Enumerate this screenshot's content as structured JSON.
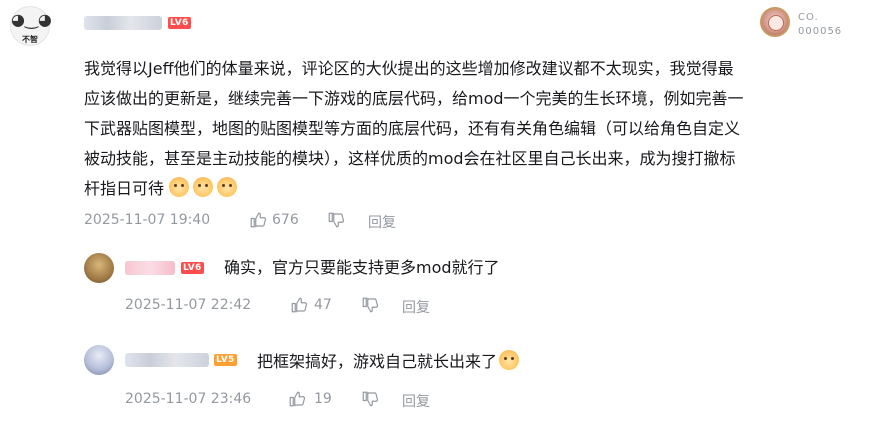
{
  "comment": {
    "author_avatar_text": "不智",
    "level_badge": "LV6",
    "medal": {
      "line1": "CO.",
      "line2": "000056"
    },
    "text_lines": [
      "我觉得以Jeff他们的体量来说，评论区的大伙提出的这些增加修改建议都不太现实，我觉得最",
      "应该做出的更新是，继续完善一下游戏的底层代码，给mod一个完美的生长环境，例如完善一",
      "下武器贴图模型，地图的贴图模型等方面的底层代码，还有有关角色编辑（可以给角色自定义",
      "被动技能，甚至是主动技能的模块），这样优质的mod会在社区里自己长出来，成为搜打撤标",
      "杆指日可待"
    ],
    "emojis": [
      "doge-emoji",
      "doge-emoji",
      "doge-emoji"
    ],
    "time": "2025-11-07 19:40",
    "likes": "676",
    "reply_label": "回复"
  },
  "replies": [
    {
      "level_badge": "LV6",
      "text": "确实，官方只要能支持更多mod就行了",
      "time": "2025-11-07 22:42",
      "likes": "47",
      "reply_label": "回复"
    },
    {
      "level_badge": "LV5",
      "text": "把框架搞好，游戏自己就长出来了",
      "time": "2025-11-07 23:46",
      "likes": "19",
      "reply_label": "回复"
    }
  ]
}
